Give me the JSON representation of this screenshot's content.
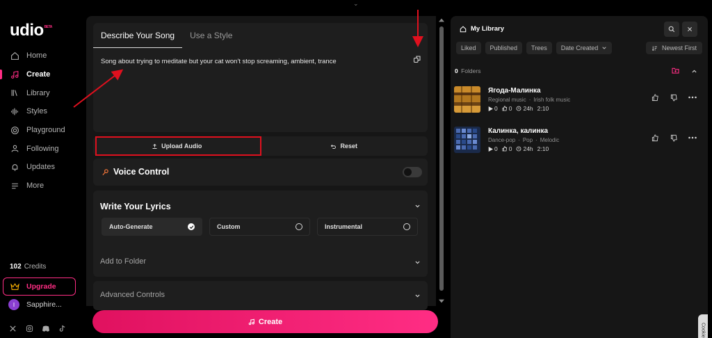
{
  "brand": {
    "name": "udio",
    "badge": "BETA"
  },
  "sidebar": {
    "items": [
      {
        "label": "Home",
        "icon": "home-icon"
      },
      {
        "label": "Create",
        "icon": "music-note-icon",
        "active": true
      },
      {
        "label": "Library",
        "icon": "library-icon"
      },
      {
        "label": "Styles",
        "icon": "waveform-icon"
      },
      {
        "label": "Playground",
        "icon": "playground-icon"
      },
      {
        "label": "Following",
        "icon": "user-icon"
      },
      {
        "label": "Updates",
        "icon": "bell-icon"
      },
      {
        "label": "More",
        "icon": "menu-icon"
      }
    ],
    "credits_count": "102",
    "credits_label": "Credits",
    "upgrade_label": "Upgrade",
    "user_initial": "I",
    "user_name": "Sapphire..."
  },
  "create": {
    "tabs": [
      "Describe Your Song",
      "Use a Style"
    ],
    "prompt": "Song about trying to meditate but your cat won't stop screaming, ambient, trance",
    "upload_label": "Upload Audio",
    "reset_label": "Reset",
    "voice_control_label": "Voice Control",
    "lyrics_title": "Write Your Lyrics",
    "lyrics_options": [
      "Auto-Generate",
      "Custom",
      "Instrumental"
    ],
    "add_to_folder_label": "Add to Folder",
    "advanced_controls_label": "Advanced Controls",
    "create_button_label": "Create"
  },
  "library": {
    "title": "My Library",
    "filters": [
      "Liked",
      "Published",
      "Trees",
      "Date Created"
    ],
    "sort_label": "Newest First",
    "folders_count": "0",
    "folders_label": "Folders",
    "songs": [
      {
        "title": "Ягода-Малинка",
        "tags": [
          "Regional music",
          "·",
          "Irish folk music"
        ],
        "plays": "0",
        "likes": "0",
        "age": "24h",
        "duration": "2:10"
      },
      {
        "title": "Калинка, калинка",
        "tags": [
          "Dance-pop",
          "·",
          "Pop",
          "·",
          "Melodic"
        ],
        "plays": "0",
        "likes": "0",
        "age": "24h",
        "duration": "2:10"
      }
    ]
  },
  "cookie_label": "Cookie",
  "colors": {
    "accent": "#ff2d84",
    "annotation": "#e0101e",
    "background": "#000000",
    "panel": "#161616"
  }
}
